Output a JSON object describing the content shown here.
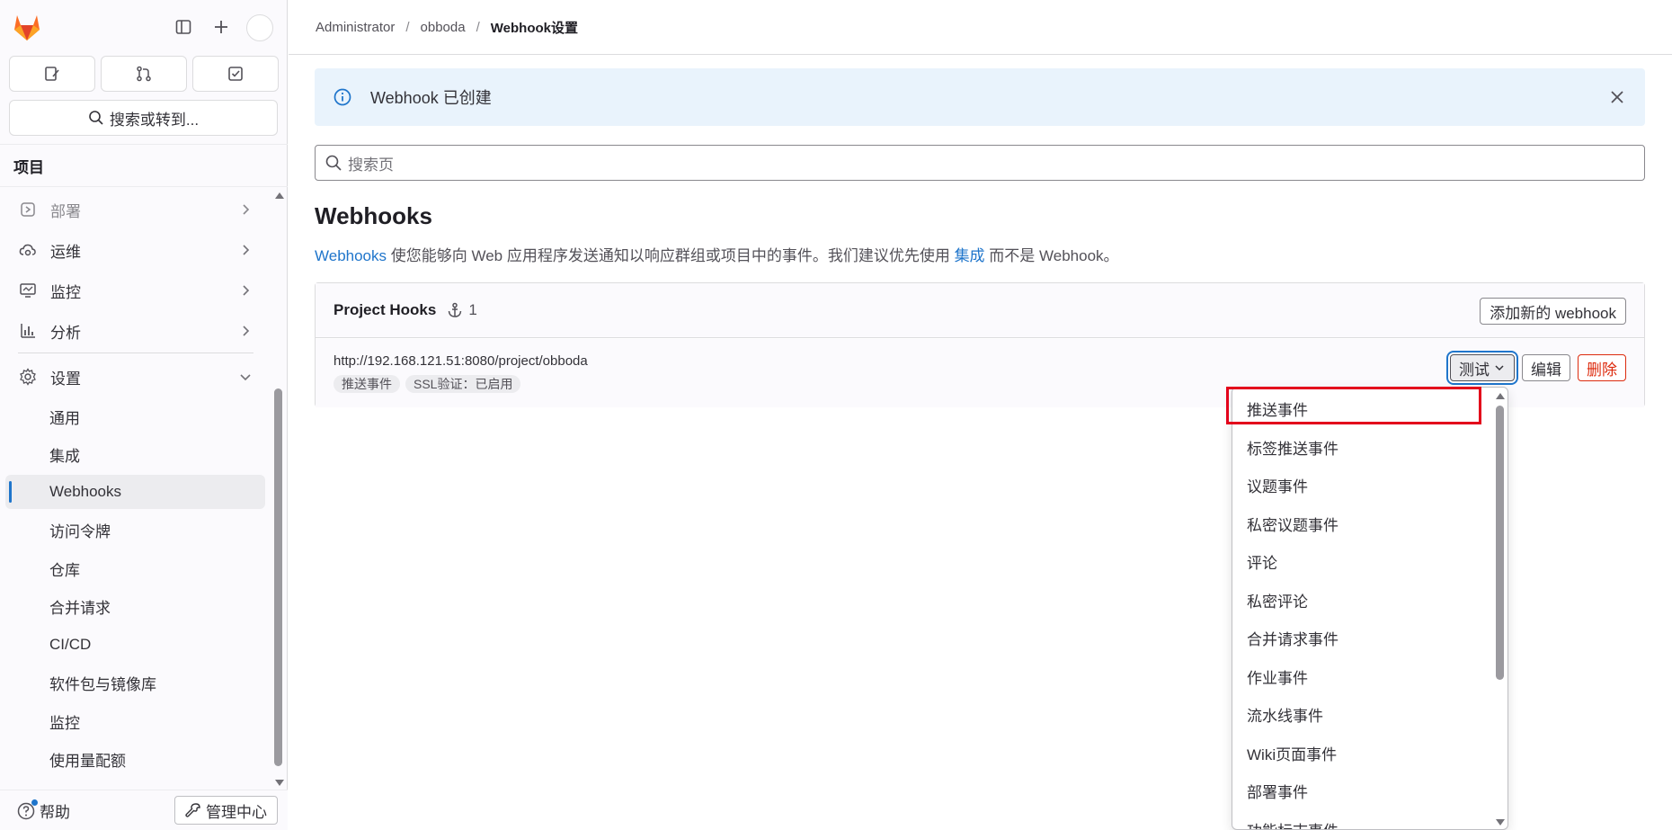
{
  "sidebar": {
    "search_label": "搜索或转到...",
    "section_title": "项目",
    "nav": [
      {
        "label": "部署"
      },
      {
        "label": "运维"
      },
      {
        "label": "监控"
      },
      {
        "label": "分析"
      },
      {
        "label": "设置"
      }
    ],
    "settings_sub": [
      {
        "label": "通用"
      },
      {
        "label": "集成"
      },
      {
        "label": "Webhooks"
      },
      {
        "label": "访问令牌"
      },
      {
        "label": "仓库"
      },
      {
        "label": "合并请求"
      },
      {
        "label": "CI/CD"
      },
      {
        "label": "软件包与镜像库"
      },
      {
        "label": "监控"
      },
      {
        "label": "使用量配额"
      }
    ],
    "help_label": "帮助",
    "admin_label": "管理中心"
  },
  "breadcrumb": {
    "items": [
      "Administrator",
      "obboda"
    ],
    "current": "Webhook设置",
    "separator": "/"
  },
  "alert": {
    "message": "Webhook 已创建"
  },
  "page_search": {
    "placeholder": "搜索页"
  },
  "page": {
    "title": "Webhooks",
    "desc_link1": "Webhooks",
    "desc_mid": " 使您能够向 Web 应用程序发送通知以响应群组或项目中的事件。我们建议优先使用 ",
    "desc_link2": "集成",
    "desc_end": " 而不是 Webhook。"
  },
  "hooks": {
    "title": "Project Hooks",
    "count": "1",
    "add_label": "添加新的 webhook",
    "items": [
      {
        "url": "http://192.168.121.51:8080/project/obboda",
        "tags": [
          "推送事件",
          "SSL验证：已启用"
        ]
      }
    ],
    "test_label": "测试",
    "edit_label": "编辑",
    "delete_label": "删除"
  },
  "dropdown": {
    "items": [
      "推送事件",
      "标签推送事件",
      "议题事件",
      "私密议题事件",
      "评论",
      "私密评论",
      "合并请求事件",
      "作业事件",
      "流水线事件",
      "Wiki页面事件",
      "部署事件",
      "功能标志事件"
    ],
    "highlighted_item": "推送事件"
  },
  "colors": {
    "accent": "#1f75cb",
    "danger": "#dd2b0e",
    "highlight_box": "#e3001b",
    "alert_bg": "#e9f3fc",
    "brand_logo": "#e24329"
  }
}
